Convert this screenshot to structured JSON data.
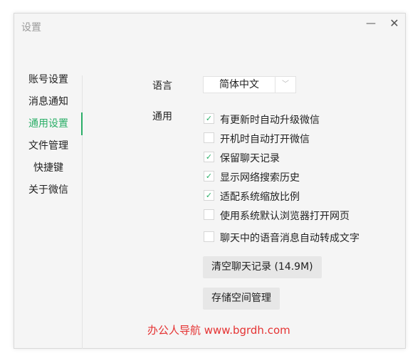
{
  "window": {
    "title": "设置",
    "minimize_icon": "minimize-icon",
    "close_icon": "close-icon"
  },
  "sidebar": {
    "items": [
      {
        "label": "账号设置"
      },
      {
        "label": "消息通知"
      },
      {
        "label": "通用设置",
        "active": true
      },
      {
        "label": "文件管理"
      },
      {
        "label": "快捷键"
      },
      {
        "label": "关于微信"
      }
    ]
  },
  "general": {
    "language_label": "语言",
    "language_value": "简体中文",
    "general_label": "通用",
    "options": [
      {
        "label": "有更新时自动升级微信",
        "checked": true
      },
      {
        "label": "开机时自动打开微信",
        "checked": false
      },
      {
        "label": "保留聊天记录",
        "checked": true
      },
      {
        "label": "显示网络搜索历史",
        "checked": true
      },
      {
        "label": "适配系统缩放比例",
        "checked": true
      },
      {
        "label": "使用系统默认浏览器打开网页",
        "checked": false
      },
      {
        "label": "聊天中的语音消息自动转成文字",
        "checked": false
      }
    ],
    "clear_history_button": "清空聊天记录 (14.9M)",
    "storage_button": "存储空间管理"
  },
  "watermark": "办公人导航  www.bgrdh.com",
  "colors": {
    "accent": "#2aae67",
    "watermark": "#e53333"
  }
}
